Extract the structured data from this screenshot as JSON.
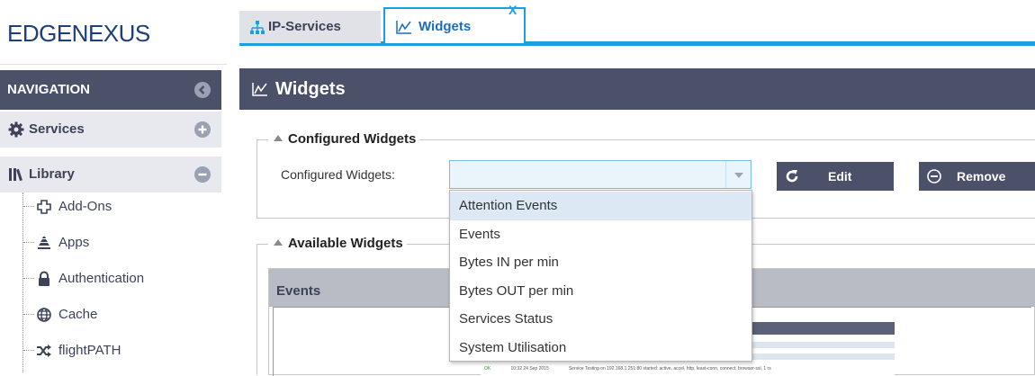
{
  "brand": {
    "logo_text": "EDGENEXUS"
  },
  "sidebar": {
    "nav_title": "NAVIGATION",
    "sections": [
      {
        "label": "Services",
        "icon": "gear-icon",
        "toggle": "plus-icon"
      },
      {
        "label": "Library",
        "icon": "library-icon",
        "toggle": "minus-icon"
      }
    ],
    "library_items": [
      {
        "label": "Add-Ons",
        "icon": "puzzle-icon"
      },
      {
        "label": "Apps",
        "icon": "apps-stack-icon"
      },
      {
        "label": "Authentication",
        "icon": "lock-icon"
      },
      {
        "label": "Cache",
        "icon": "globe-icon"
      },
      {
        "label": "flightPATH",
        "icon": "shuffle-icon"
      }
    ]
  },
  "tabs": [
    {
      "label": "IP-Services",
      "icon": "network-icon",
      "active": false
    },
    {
      "label": "Widgets",
      "icon": "chart-line-icon",
      "active": true,
      "close": "X"
    }
  ],
  "panel": {
    "title": "Widgets",
    "configured_group": {
      "legend": "Configured Widgets",
      "field_label": "Configured Widgets:",
      "select_value": "",
      "edit_label": "Edit",
      "remove_label": "Remove"
    },
    "dropdown_options": [
      "Attention Events",
      "Events",
      "Bytes IN per min",
      "Bytes OUT per min",
      "Services Status",
      "System Utilisation"
    ],
    "selected_option": "Attention Events",
    "available_group": {
      "legend": "Available Widgets",
      "preview_title": "Events",
      "preview_row": {
        "status": "OK",
        "time": "10:32 24 Sep 2015",
        "message": "Service Testing on 192.168.1.251:80 started: active, accel, http, least-conn, connect, browser-ssl, 1 rs"
      }
    }
  },
  "colors": {
    "nav_dark": "#4a5169",
    "accent_blue": "#1a9fe2",
    "section_bg": "#e7e9ee",
    "select_bg": "#e9f4fb",
    "dropdown_selected": "#dce9f5"
  }
}
